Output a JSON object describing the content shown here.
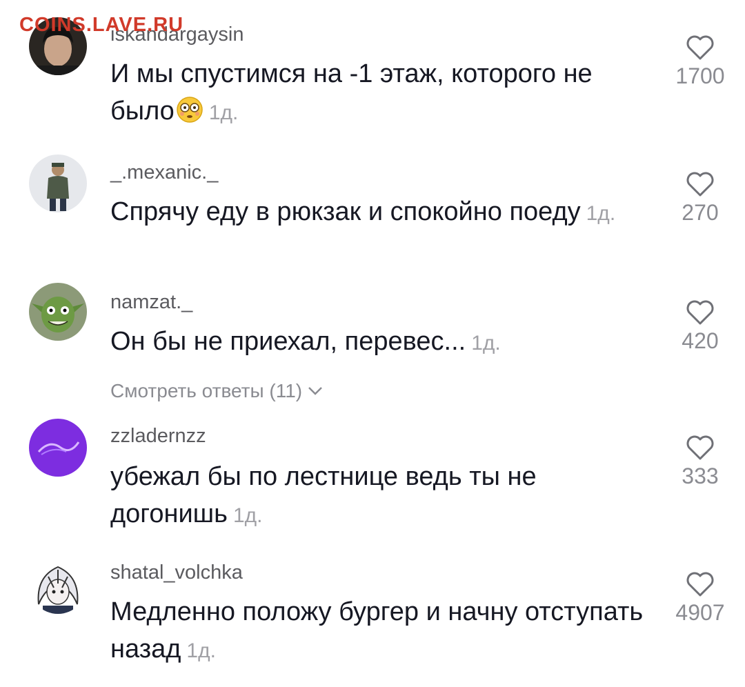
{
  "watermark": "COINS.LAVE.RU",
  "comments": [
    {
      "username": "iskandargaysin",
      "text": "И мы спустимся на -1 этаж, которого не было",
      "emoji": "flushed-face",
      "time": "1д.",
      "likes": "1700"
    },
    {
      "username": "_.mexanic._",
      "text": "Спрячу еду в рюкзак и спокойно поеду",
      "time": "1д.",
      "likes": "270"
    },
    {
      "username": "namzat._",
      "text": "Он бы не приехал, перевес...",
      "time": "1д.",
      "likes": "420"
    },
    {
      "username": "zzladernzz",
      "text": "убежал бы по лестнице ведь ты не догонишь",
      "time": "1д.",
      "likes": "333"
    },
    {
      "username": "shatal_volchka",
      "text": "Медленно положу бургер и начну отступать назад",
      "time": "1д.",
      "likes": "4907"
    }
  ],
  "replies_link": {
    "label": "Смотреть ответы (11)"
  },
  "icons": {
    "like": "heart-outline-icon",
    "expand": "chevron-down-icon"
  },
  "colors": {
    "text": "#161823",
    "username": "#5b5b5f",
    "muted": "#8a8b91",
    "watermark": "#d13a2a"
  }
}
